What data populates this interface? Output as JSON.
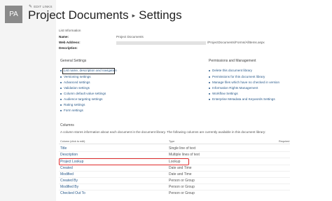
{
  "header": {
    "avatar_initials": "PA",
    "edit_links": "EDIT LINKS",
    "title_part1": "Project Documents",
    "title_sep": "▸",
    "title_part2": "Settings"
  },
  "list_info": {
    "heading": "List Information",
    "name_label": "Name:",
    "name_value": "Project Documents",
    "web_address_label": "Web Address:",
    "web_address_value": "/ProjectDocuments/Forms/AllItems.aspx",
    "description_label": "Description:"
  },
  "general_settings": {
    "heading": "General Settings",
    "items": [
      "List name, description and navigation",
      "Versioning settings",
      "Advanced settings",
      "Validation settings",
      "Column default value settings",
      "Audience targeting settings",
      "Rating settings",
      "Form settings"
    ]
  },
  "permissions": {
    "heading": "Permissions and Management",
    "items": [
      "Delete this document library",
      "Permissions for this document library",
      "Manage files which have no checked in version",
      "Information Rights Management",
      "Workflow Settings",
      "Enterprise Metadata and Keywords Settings"
    ]
  },
  "columns": {
    "heading": "Columns",
    "description": "A column stores information about each document in the document library. The following columns are currently available in this document library:",
    "headers": [
      "Column (click to edit)",
      "Type",
      "Required"
    ],
    "rows": [
      {
        "name": "Title",
        "type": "Single line of text"
      },
      {
        "name": "Description",
        "type": "Multiple lines of text"
      },
      {
        "name": "Project Lookup",
        "type": "Lookup"
      },
      {
        "name": "Created",
        "type": "Date and Time"
      },
      {
        "name": "Modified",
        "type": "Date and Time"
      },
      {
        "name": "Created By",
        "type": "Person or Group"
      },
      {
        "name": "Modified By",
        "type": "Person or Group"
      },
      {
        "name": "Checked Out To",
        "type": "Person or Group"
      }
    ]
  },
  "icons": {
    "edit": "pencil-icon",
    "bullet": "bullet-icon"
  },
  "colors": {
    "link": "#2a5a8a",
    "highlight_red": "#e02d2d"
  }
}
